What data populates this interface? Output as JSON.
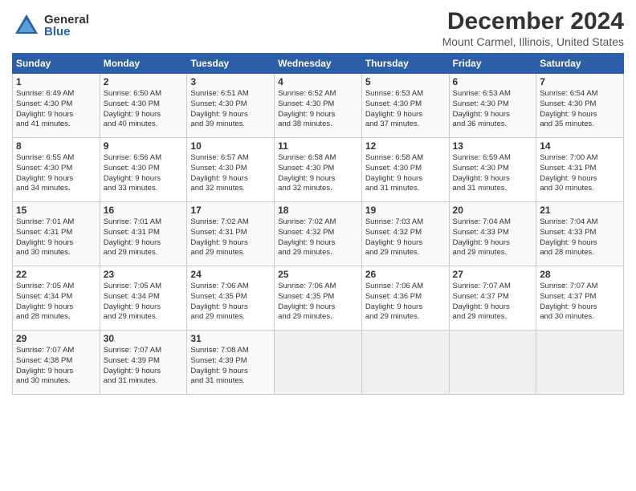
{
  "header": {
    "logo_general": "General",
    "logo_blue": "Blue",
    "title": "December 2024",
    "subtitle": "Mount Carmel, Illinois, United States"
  },
  "days_of_week": [
    "Sunday",
    "Monday",
    "Tuesday",
    "Wednesday",
    "Thursday",
    "Friday",
    "Saturday"
  ],
  "weeks": [
    [
      {
        "day": "1",
        "detail": "Sunrise: 6:49 AM\nSunset: 4:30 PM\nDaylight: 9 hours\nand 41 minutes."
      },
      {
        "day": "2",
        "detail": "Sunrise: 6:50 AM\nSunset: 4:30 PM\nDaylight: 9 hours\nand 40 minutes."
      },
      {
        "day": "3",
        "detail": "Sunrise: 6:51 AM\nSunset: 4:30 PM\nDaylight: 9 hours\nand 39 minutes."
      },
      {
        "day": "4",
        "detail": "Sunrise: 6:52 AM\nSunset: 4:30 PM\nDaylight: 9 hours\nand 38 minutes."
      },
      {
        "day": "5",
        "detail": "Sunrise: 6:53 AM\nSunset: 4:30 PM\nDaylight: 9 hours\nand 37 minutes."
      },
      {
        "day": "6",
        "detail": "Sunrise: 6:53 AM\nSunset: 4:30 PM\nDaylight: 9 hours\nand 36 minutes."
      },
      {
        "day": "7",
        "detail": "Sunrise: 6:54 AM\nSunset: 4:30 PM\nDaylight: 9 hours\nand 35 minutes."
      }
    ],
    [
      {
        "day": "8",
        "detail": "Sunrise: 6:55 AM\nSunset: 4:30 PM\nDaylight: 9 hours\nand 34 minutes."
      },
      {
        "day": "9",
        "detail": "Sunrise: 6:56 AM\nSunset: 4:30 PM\nDaylight: 9 hours\nand 33 minutes."
      },
      {
        "day": "10",
        "detail": "Sunrise: 6:57 AM\nSunset: 4:30 PM\nDaylight: 9 hours\nand 32 minutes."
      },
      {
        "day": "11",
        "detail": "Sunrise: 6:58 AM\nSunset: 4:30 PM\nDaylight: 9 hours\nand 32 minutes."
      },
      {
        "day": "12",
        "detail": "Sunrise: 6:58 AM\nSunset: 4:30 PM\nDaylight: 9 hours\nand 31 minutes."
      },
      {
        "day": "13",
        "detail": "Sunrise: 6:59 AM\nSunset: 4:30 PM\nDaylight: 9 hours\nand 31 minutes."
      },
      {
        "day": "14",
        "detail": "Sunrise: 7:00 AM\nSunset: 4:31 PM\nDaylight: 9 hours\nand 30 minutes."
      }
    ],
    [
      {
        "day": "15",
        "detail": "Sunrise: 7:01 AM\nSunset: 4:31 PM\nDaylight: 9 hours\nand 30 minutes."
      },
      {
        "day": "16",
        "detail": "Sunrise: 7:01 AM\nSunset: 4:31 PM\nDaylight: 9 hours\nand 29 minutes."
      },
      {
        "day": "17",
        "detail": "Sunrise: 7:02 AM\nSunset: 4:31 PM\nDaylight: 9 hours\nand 29 minutes."
      },
      {
        "day": "18",
        "detail": "Sunrise: 7:02 AM\nSunset: 4:32 PM\nDaylight: 9 hours\nand 29 minutes."
      },
      {
        "day": "19",
        "detail": "Sunrise: 7:03 AM\nSunset: 4:32 PM\nDaylight: 9 hours\nand 29 minutes."
      },
      {
        "day": "20",
        "detail": "Sunrise: 7:04 AM\nSunset: 4:33 PM\nDaylight: 9 hours\nand 29 minutes."
      },
      {
        "day": "21",
        "detail": "Sunrise: 7:04 AM\nSunset: 4:33 PM\nDaylight: 9 hours\nand 28 minutes."
      }
    ],
    [
      {
        "day": "22",
        "detail": "Sunrise: 7:05 AM\nSunset: 4:34 PM\nDaylight: 9 hours\nand 28 minutes."
      },
      {
        "day": "23",
        "detail": "Sunrise: 7:05 AM\nSunset: 4:34 PM\nDaylight: 9 hours\nand 29 minutes."
      },
      {
        "day": "24",
        "detail": "Sunrise: 7:06 AM\nSunset: 4:35 PM\nDaylight: 9 hours\nand 29 minutes."
      },
      {
        "day": "25",
        "detail": "Sunrise: 7:06 AM\nSunset: 4:35 PM\nDaylight: 9 hours\nand 29 minutes."
      },
      {
        "day": "26",
        "detail": "Sunrise: 7:06 AM\nSunset: 4:36 PM\nDaylight: 9 hours\nand 29 minutes."
      },
      {
        "day": "27",
        "detail": "Sunrise: 7:07 AM\nSunset: 4:37 PM\nDaylight: 9 hours\nand 29 minutes."
      },
      {
        "day": "28",
        "detail": "Sunrise: 7:07 AM\nSunset: 4:37 PM\nDaylight: 9 hours\nand 30 minutes."
      }
    ],
    [
      {
        "day": "29",
        "detail": "Sunrise: 7:07 AM\nSunset: 4:38 PM\nDaylight: 9 hours\nand 30 minutes."
      },
      {
        "day": "30",
        "detail": "Sunrise: 7:07 AM\nSunset: 4:39 PM\nDaylight: 9 hours\nand 31 minutes."
      },
      {
        "day": "31",
        "detail": "Sunrise: 7:08 AM\nSunset: 4:39 PM\nDaylight: 9 hours\nand 31 minutes."
      },
      {
        "day": "",
        "detail": ""
      },
      {
        "day": "",
        "detail": ""
      },
      {
        "day": "",
        "detail": ""
      },
      {
        "day": "",
        "detail": ""
      }
    ]
  ]
}
